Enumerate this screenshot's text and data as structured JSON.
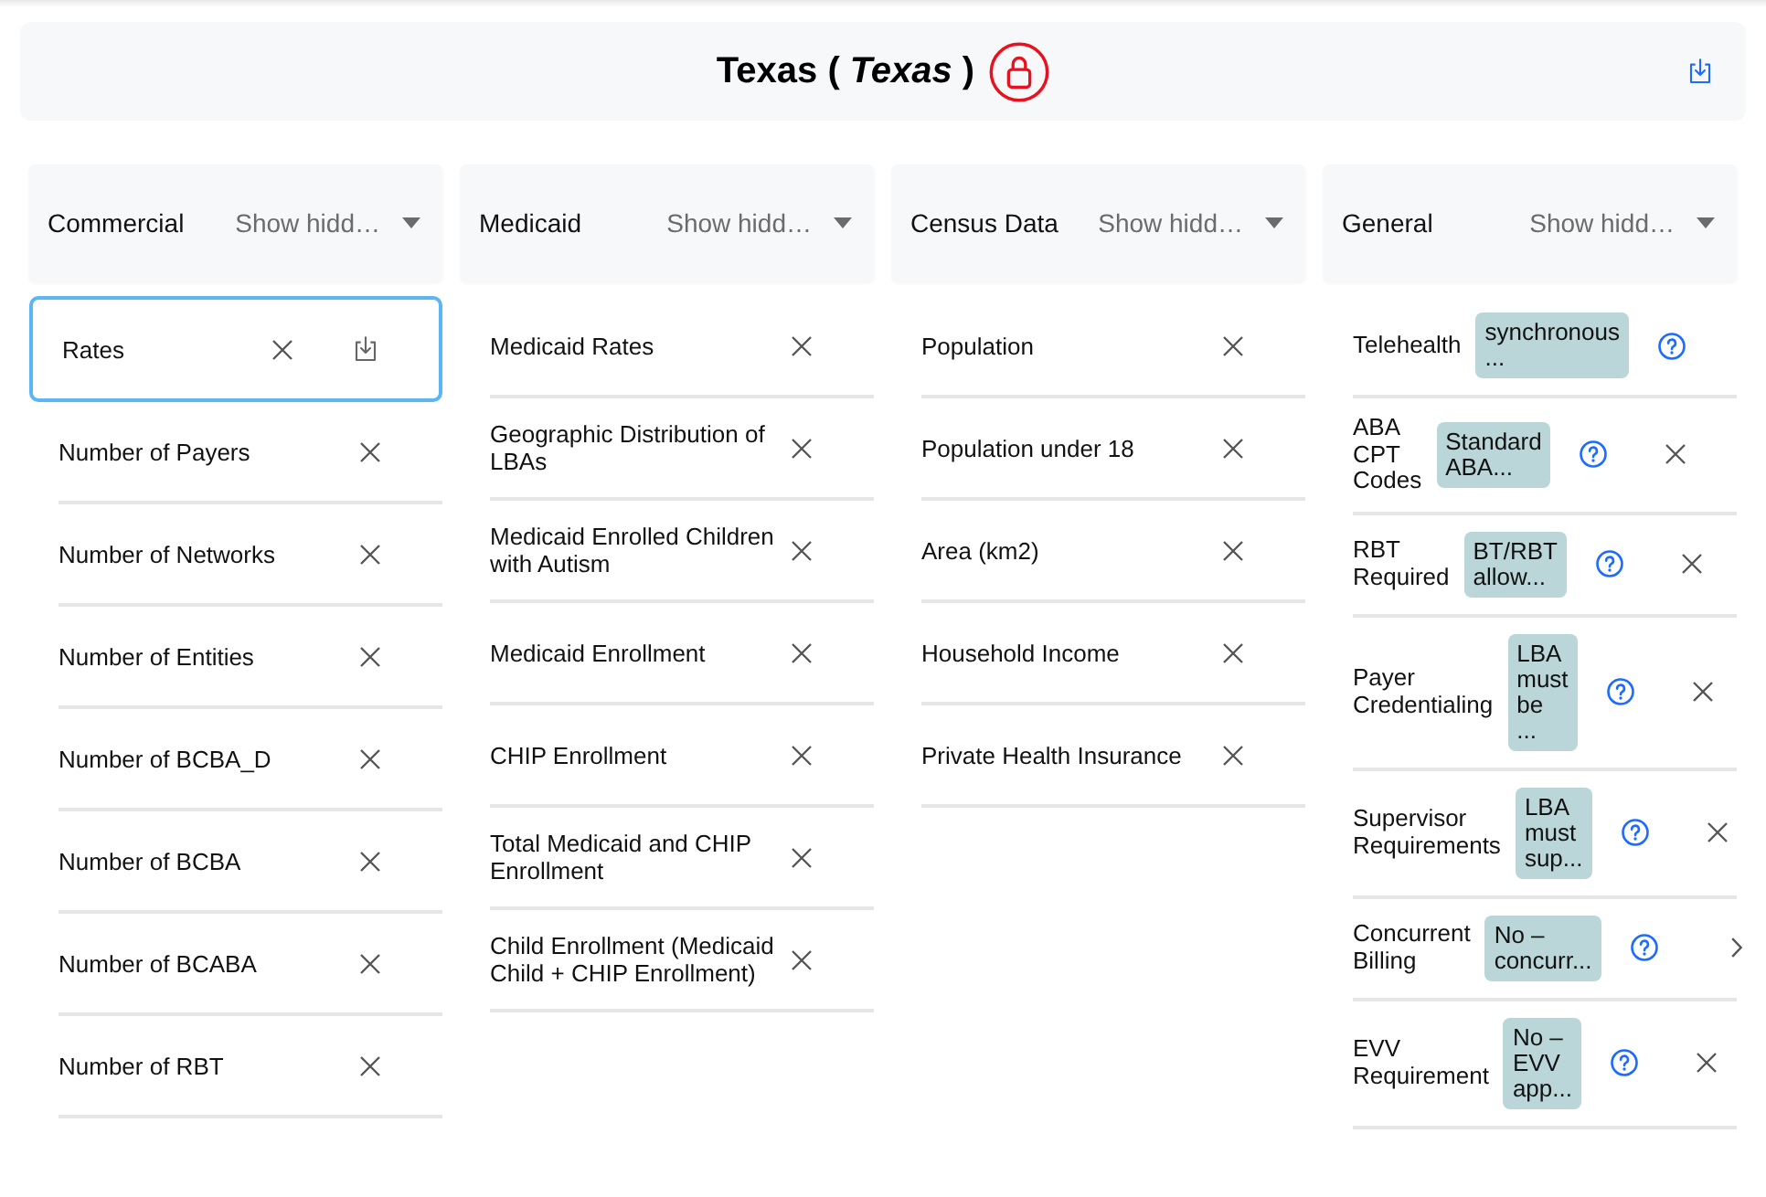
{
  "header": {
    "title": "Texas ( *Texas* )"
  },
  "columns": [
    {
      "title": "Commercial",
      "filter": "Show hidd…",
      "items": [
        {
          "label": "Rates",
          "selected": true
        },
        {
          "label": "Number of Payers",
          "selected": false
        },
        {
          "label": "Number of Networks",
          "selected": false
        },
        {
          "label": "Number of Entities",
          "selected": false
        },
        {
          "label": "Number of BCBA_D",
          "selected": false
        },
        {
          "label": "Number of BCBA",
          "selected": false
        },
        {
          "label": "Number of BCABA",
          "selected": false
        },
        {
          "label": "Number of RBT",
          "selected": false
        }
      ]
    },
    {
      "title": "Medicaid",
      "filter": "Show hidd…",
      "items": [
        {
          "label": "Medicaid Rates",
          "selected": false
        },
        {
          "label": "Geographic Distribution of LBAs",
          "selected": false
        },
        {
          "label": "Medicaid Enrolled Children with Autism",
          "selected": false
        },
        {
          "label": "Medicaid Enrollment",
          "selected": false
        },
        {
          "label": "CHIP Enrollment",
          "selected": false
        },
        {
          "label": "Total Medicaid and CHIP Enrollment",
          "selected": false
        },
        {
          "label": "Child Enrollment (Medicaid Child + CHIP Enrollment)",
          "selected": false
        }
      ]
    },
    {
      "title": "Census Data",
      "filter": "Show hidd…",
      "items": [
        {
          "label": "Population",
          "selected": false
        },
        {
          "label": "Population under 18",
          "selected": false
        },
        {
          "label": "Area (km2)",
          "selected": false
        },
        {
          "label": "Household Income",
          "selected": false
        },
        {
          "label": "Private Health Insurance",
          "selected": false
        }
      ]
    },
    {
      "title": "General",
      "filter": "Show hidd…",
      "items": [
        {
          "label": "Telehealth",
          "value": "synchronous ...",
          "removable": false,
          "expandable": false,
          "selected": false
        },
        {
          "label": "ABA CPT Codes",
          "value": "Standard ABA...",
          "removable": true,
          "expandable": false,
          "selected": false
        },
        {
          "label": "RBT Required",
          "value": "BT/RBT allow...",
          "removable": true,
          "expandable": false,
          "selected": false
        },
        {
          "label": "Payer Credentialing",
          "value": "LBA must be ...",
          "removable": true,
          "expandable": false,
          "selected": false
        },
        {
          "label": "Supervisor Requirements",
          "value": "LBA must sup...",
          "removable": true,
          "expandable": false,
          "selected": false
        },
        {
          "label": "Concurrent Billing",
          "value": "No – concurr...",
          "removable": false,
          "expandable": true,
          "selected": false
        },
        {
          "label": "EVV Requirement",
          "value": "No – EVV app...",
          "removable": true,
          "expandable": false,
          "selected": false
        }
      ]
    }
  ]
}
